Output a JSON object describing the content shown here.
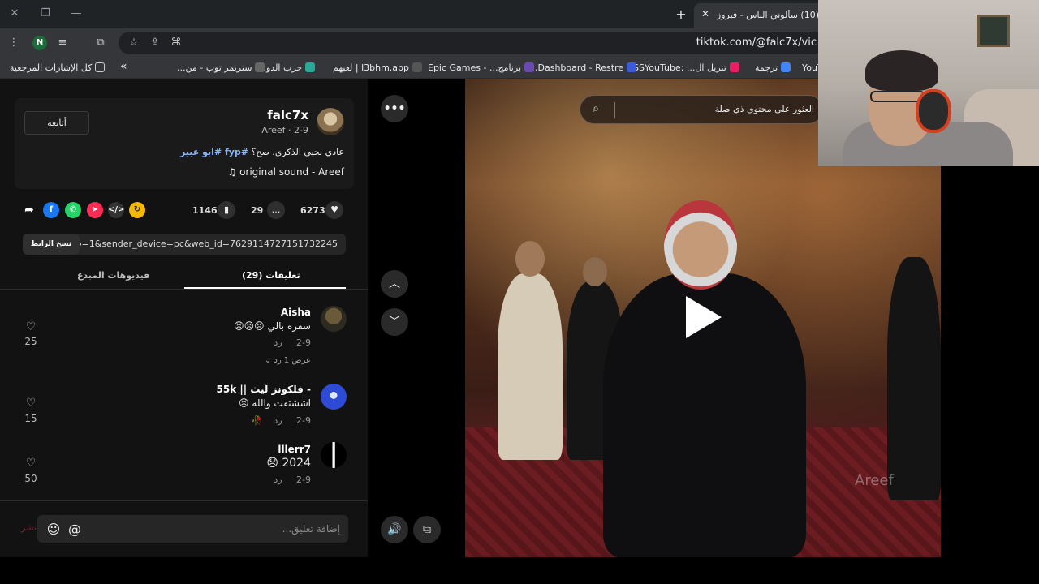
{
  "browser": {
    "tab": {
      "title": "(10) سألوني الناس - فيروز | ube"
    },
    "url": "tiktok.com/@falc7x/vic",
    "profile_initial": "N",
    "bookmarks": [
      {
        "label": "YouT"
      },
      {
        "label": "ترجمة"
      },
      {
        "label": "تنزيل ال... :SSYouTube"
      },
      {
        "label": "Dashboard - Restre..."
      },
      {
        "label": "برنامج... - Epic Games"
      },
      {
        "label": "l3bhm.app | لعبهم"
      },
      {
        "label": "حرب الدول"
      },
      {
        "label": "ستريمر توب - من..."
      }
    ],
    "all_bookmarks": "كل الإشارات المرجعية"
  },
  "post": {
    "username": "falc7x",
    "subname": "Areef · 2-9",
    "follow_label": "أتابعه",
    "caption_text": "عادي نحبي الذكرى، صح؟",
    "caption_tags": "#fyp #ابو عبير",
    "sound": "♫ original sound - Areef",
    "likes": "6273",
    "comments": "29",
    "saves": "1146",
    "link": "...pp=1&sender_device=pc&web_id=7629114727151732245",
    "copy_label": "نسخ الرابط"
  },
  "tabs": {
    "comments": "تعليقات (29)",
    "creator_videos": "فيديوهات المبدع"
  },
  "comments": [
    {
      "name": "Aisha",
      "text": "سفره بالي 😣😣😣",
      "date": "2-9",
      "reply": "رد",
      "likes": "25",
      "view_replies": "عرض 1 رد"
    },
    {
      "name": "- فلكونز لَيث || 55k",
      "text": "اششتقت والله 😣",
      "date": "2-9",
      "reply": "رد",
      "likes": "15"
    },
    {
      "name": "lllerr7",
      "text": "2024 😞",
      "date": "2-9",
      "reply": "رد",
      "likes": "50"
    }
  ],
  "comment_input": {
    "placeholder": "إضافة تعليق...",
    "post_label": "نشر"
  },
  "video": {
    "search_placeholder": "العثور على محتوى ذي صلة",
    "watermark": "Areef"
  },
  "colors": {
    "accent_link": "#8ab4f8",
    "panel_bg": "#121212",
    "chrome_bg": "#35363a"
  }
}
